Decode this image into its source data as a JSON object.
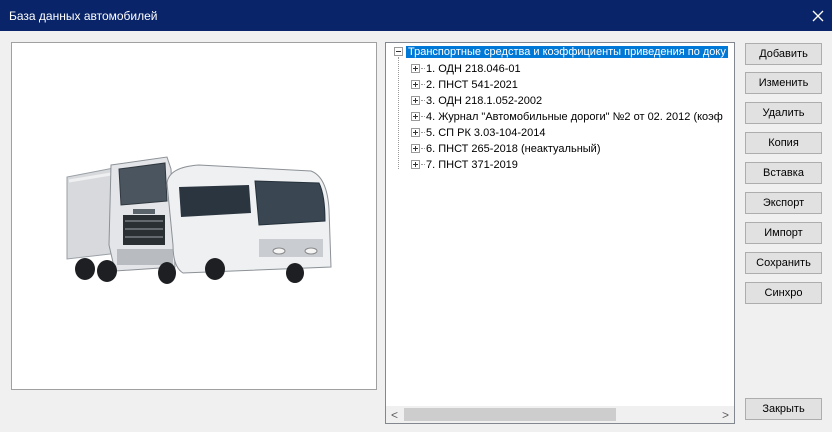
{
  "window": {
    "title": "База данных автомобилей",
    "close_icon": "close-icon"
  },
  "tree": {
    "root_label": "Транспортные средства и коэффициенты приведения по доку",
    "items": [
      "1. ОДН 218.046-01",
      "2. ПНСТ 541-2021",
      "3. ОДН 218.1.052-2002",
      "4. Журнал \"Автомобильные дороги\" №2 от 02. 2012 (коэф",
      "5. СП РК 3.03-104-2014",
      "6. ПНСТ 265-2018 (неактуальный)",
      "7. ПНСТ 371-2019"
    ]
  },
  "buttons": {
    "add": "Добавить",
    "edit": "Изменить",
    "delete": "Удалить",
    "copy": "Копия",
    "paste": "Вставка",
    "export": "Экспорт",
    "import": "Импорт",
    "save": "Сохранить",
    "sync": "Синхро",
    "close": "Закрыть"
  },
  "scrollbar": {
    "left_arrow": "<",
    "right_arrow": ">"
  },
  "colors": {
    "titlebar": "#0a2469",
    "selection": "#0078d7"
  }
}
